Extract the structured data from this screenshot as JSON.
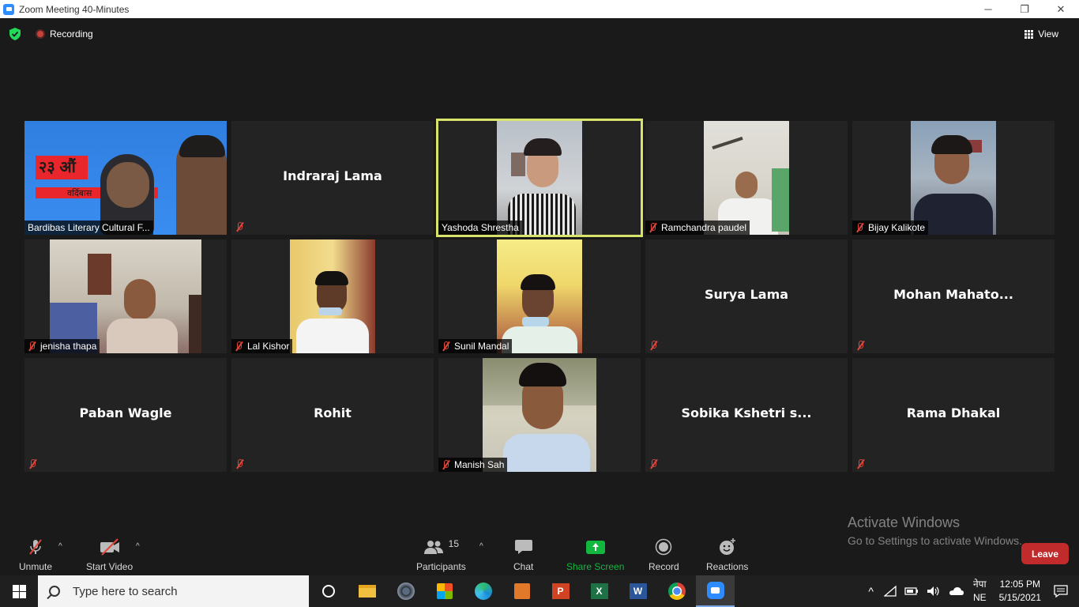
{
  "window": {
    "title": "Zoom Meeting 40-Minutes",
    "minimize": "─",
    "restore": "❐",
    "close": "✕"
  },
  "topbar": {
    "recording_label": "Recording",
    "view_label": "View"
  },
  "tiles": [
    {
      "name": "Bardibas Literary Cultural F...",
      "video": true,
      "muted": false,
      "banner_text": "२३ औं",
      "banner_sub": "वर्दिबास"
    },
    {
      "name": "Indraraj Lama",
      "video": false,
      "muted": true
    },
    {
      "name": "Yashoda Shrestha",
      "video": true,
      "muted": false,
      "active": true
    },
    {
      "name": "Ramchandra paudel",
      "video": true,
      "muted": true
    },
    {
      "name": "Bijay Kalikote",
      "video": true,
      "muted": true
    },
    {
      "name": "jenisha thapa",
      "video": true,
      "muted": true
    },
    {
      "name": "Lal Kishor",
      "video": true,
      "muted": true
    },
    {
      "name": "Sunil Mandal",
      "video": true,
      "muted": true
    },
    {
      "name": "Surya Lama",
      "video": false,
      "muted": true
    },
    {
      "name": "Mohan  Mahato...",
      "video": false,
      "muted": true
    },
    {
      "name": "Paban Wagle",
      "video": false,
      "muted": true
    },
    {
      "name": "Rohit",
      "video": false,
      "muted": true
    },
    {
      "name": "Manish Sah",
      "video": true,
      "muted": true
    },
    {
      "name": "Sobika  Kshetri s...",
      "video": false,
      "muted": true
    },
    {
      "name": "Rama Dhakal",
      "video": false,
      "muted": true
    }
  ],
  "watermark": {
    "line1": "Activate Windows",
    "line2": "Go to Settings to activate Windows."
  },
  "toolbar": {
    "unmute": "Unmute",
    "start_video": "Start Video",
    "participants": "Participants",
    "participants_count": "15",
    "chat": "Chat",
    "share_screen": "Share Screen",
    "record": "Record",
    "reactions": "Reactions",
    "leave": "Leave",
    "caret": "^"
  },
  "taskbar": {
    "search_placeholder": "Type here to search",
    "lang_top": "नेपा",
    "lang_bottom": "NE",
    "time": "12:05 PM",
    "date": "5/15/2021"
  },
  "colors": {
    "share_green": "#12b73f",
    "leave_red": "#c22b2b",
    "active_border": "#d7e36a",
    "mute_red": "#e0463b"
  }
}
